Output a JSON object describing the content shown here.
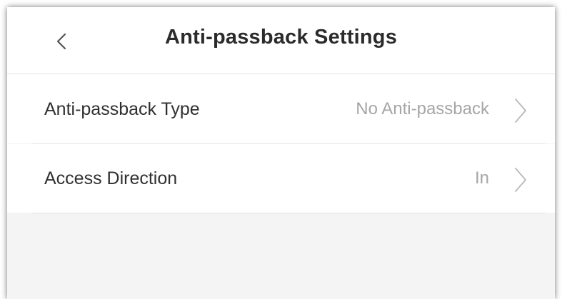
{
  "header": {
    "title": "Anti-passback Settings",
    "back_icon": "chevron-left-icon"
  },
  "settings": {
    "items": [
      {
        "label": "Anti-passback Type",
        "value": "No Anti-passback",
        "icon": "chevron-right-icon"
      },
      {
        "label": "Access Direction",
        "value": "In",
        "icon": "chevron-right-icon"
      }
    ]
  },
  "colors": {
    "title": "#2b2b2b",
    "label": "#303030",
    "value": "#a6a6a6",
    "chevron": "#b8b8b8",
    "background": "#f4f4f4",
    "surface": "#ffffff"
  }
}
